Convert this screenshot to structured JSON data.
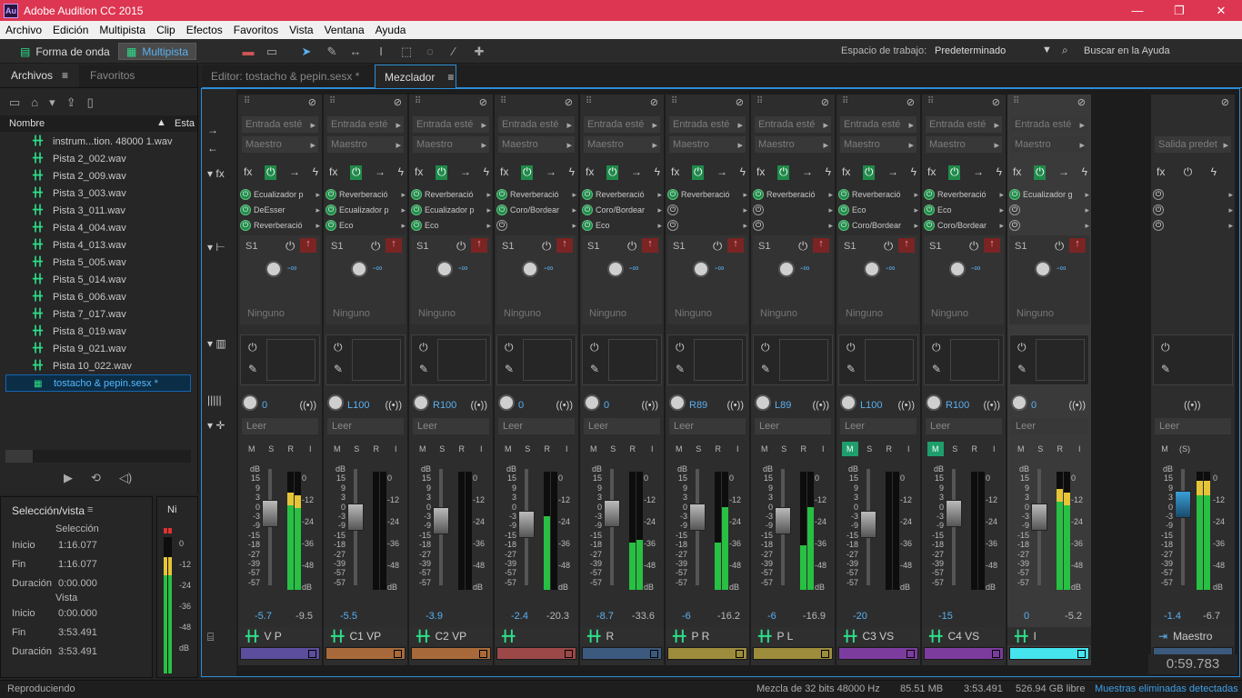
{
  "window": {
    "title": "Adobe Audition CC 2015",
    "logo": "Au",
    "minimize": "—",
    "maximize": "❐",
    "close": "✕"
  },
  "menu": [
    "Archivo",
    "Edición",
    "Multipista",
    "Clip",
    "Efectos",
    "Favoritos",
    "Vista",
    "Ventana",
    "Ayuda"
  ],
  "toolbar": {
    "waveform_label": "Forma de onda",
    "multitrack_label": "Multipista",
    "workspace_label": "Espacio de trabajo:",
    "workspace_value": "Predeterminado",
    "help_search": "Buscar en la Ayuda"
  },
  "left_panel": {
    "tab_files": "Archivos",
    "tab_favorites": "Favoritos",
    "col_name": "Nombre",
    "col_status": "Esta",
    "files": [
      "instrum...tion. 48000 1.wav",
      "Pista 2_002.wav",
      "Pista 2_009.wav",
      "Pista 3_003.wav",
      "Pista 3_011.wav",
      "Pista 4_004.wav",
      "Pista 4_013.wav",
      "Pista 5_005.wav",
      "Pista 5_014.wav",
      "Pista 6_006.wav",
      "Pista 7_017.wav",
      "Pista 8_019.wav",
      "Pista 9_021.wav",
      "Pista 10_022.wav"
    ],
    "session_file": "tostacho & pepin.sesx *"
  },
  "selection": {
    "title": "Selección/vista",
    "sel_header": "Selección",
    "view_header": "Vista",
    "inicio_label": "Inicio",
    "fin_label": "Fin",
    "dur_label": "Duración",
    "sel_inicio": "1:16.077",
    "sel_fin": "1:16.077",
    "sel_dur": "0:00.000",
    "view_inicio": "0:00.000",
    "view_fin": "3:53.491",
    "view_dur": "3:53.491"
  },
  "levels_tab": "Ni",
  "editor": {
    "tab_editor": "Editor: tostacho & pepin.sesx *",
    "tab_mixer": "Mezclador"
  },
  "mixer": {
    "input_default": "Entrada esté",
    "output_default": "Maestro",
    "read_label": "Leer",
    "send_label": "S1",
    "send_none": "Ninguno",
    "send_vol": "-∞",
    "channels": [
      {
        "name": "V P",
        "color": "#5c4e9c",
        "fx": [
          "Ecualizador p",
          "DeEsser",
          "Reverberació"
        ],
        "pan": "0",
        "vol": "-5.7",
        "peak": "-9.5",
        "m": false
      },
      {
        "name": "C1 VP",
        "color": "#a86a3a",
        "fx": [
          "Reverberació",
          "Ecualizador p",
          "Eco"
        ],
        "pan": "L100",
        "vol": "-5.5",
        "peak": "",
        "m": false
      },
      {
        "name": "C2 VP",
        "color": "#a86a3a",
        "fx": [
          "Reverberació",
          "Ecualizador p",
          "Eco"
        ],
        "pan": "R100",
        "vol": "-3.9",
        "peak": "",
        "m": false
      },
      {
        "name": "",
        "color": "#9c4848",
        "fx": [
          "Reverberació",
          "Coro/Bordear",
          ""
        ],
        "pan": "0",
        "vol": "-2.4",
        "peak": "-20.3",
        "m": false
      },
      {
        "name": "R",
        "color": "#3c5a7e",
        "fx": [
          "Reverberació",
          "Coro/Bordear",
          "Eco"
        ],
        "pan": "0",
        "vol": "-8.7",
        "peak": "-33.6",
        "m": false
      },
      {
        "name": "P R",
        "color": "#9c8c3c",
        "fx": [
          "Reverberació",
          "",
          ""
        ],
        "pan": "R89",
        "vol": "-6",
        "peak": "-16.2",
        "m": false
      },
      {
        "name": "P L",
        "color": "#9c8c3c",
        "fx": [
          "Reverberació",
          "",
          ""
        ],
        "pan": "L89",
        "vol": "-6",
        "peak": "-16.9",
        "m": false
      },
      {
        "name": "C3 VS",
        "color": "#7c3c9e",
        "fx": [
          "Reverberació",
          "Eco",
          "Coro/Bordear"
        ],
        "pan": "L100",
        "vol": "-20",
        "peak": "",
        "m": true
      },
      {
        "name": "C4 VS",
        "color": "#7c3c9e",
        "fx": [
          "Reverberació",
          "Eco",
          "Coro/Bordear"
        ],
        "pan": "R100",
        "vol": "-15",
        "peak": "",
        "m": true
      },
      {
        "name": "I",
        "color": "#46e4ec",
        "fx": [
          "Ecualizador g",
          "",
          ""
        ],
        "pan": "0",
        "vol": "0",
        "peak": "-5.2",
        "m": false
      }
    ],
    "master": {
      "input": "Salida predet",
      "name": "Maestro",
      "vol": "-1.4",
      "peak": "-6.7",
      "s": "(S)"
    },
    "timecode": "0:59.783",
    "db_scale": [
      "dB",
      "15",
      "9",
      "3",
      "0",
      "-3",
      "-9",
      "-15",
      "-18",
      "-27",
      "-39",
      "-57",
      "-57"
    ],
    "meter_scale": [
      "0",
      "-12",
      "-24",
      "-36",
      "-48",
      "dB"
    ]
  },
  "status": {
    "left": "Reproduciendo",
    "mix": "Mezcla de 32 bits 48000 Hz",
    "mem": "85.51 MB",
    "dur": "3:53.491",
    "disk": "526.94 GB libre",
    "warn": "Muestras eliminadas detectadas"
  }
}
